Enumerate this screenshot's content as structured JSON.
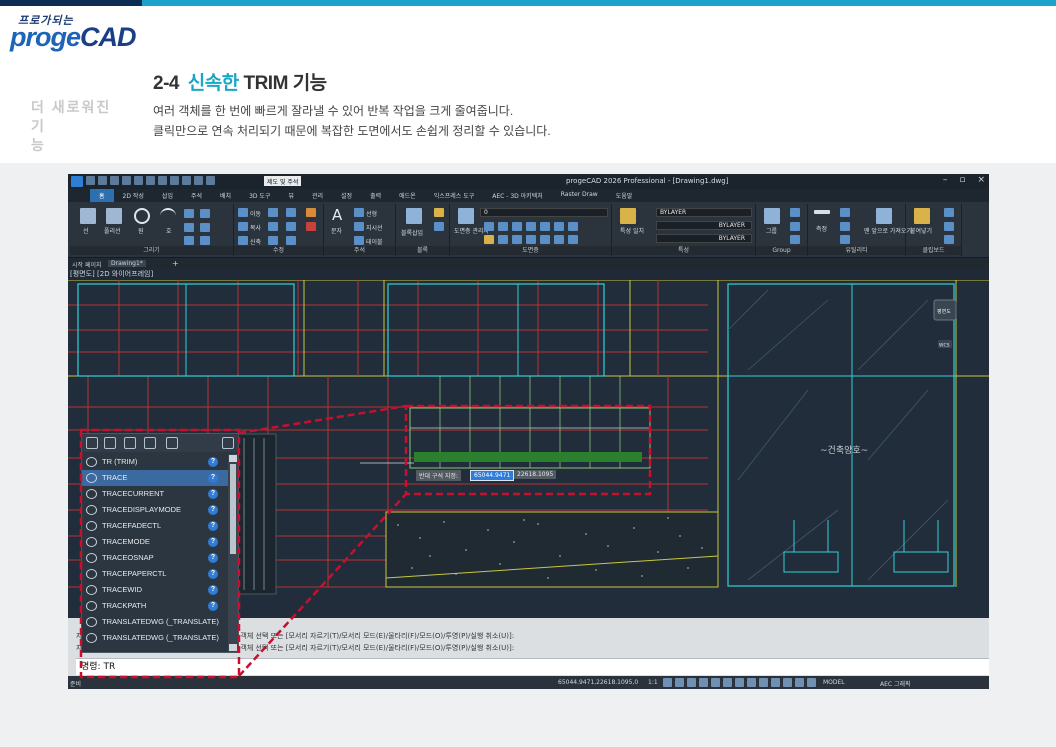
{
  "logo": {
    "tagline": "프로가되는",
    "brand_light": "proge",
    "brand_bold": "CAD"
  },
  "side_label": {
    "line1": "더 새로워진",
    "line2": "기 능"
  },
  "heading": {
    "number": "2-4",
    "title_accent": "신속한",
    "title_rest": "TRIM 기능"
  },
  "description": {
    "line1": "여러 객체를 한 번에 빠르게 잘라낼 수 있어 반복 작업을 크게 줄여줍니다.",
    "line2": "클릭만으로 연속 처리되기 때문에 복잡한 도면에서도 손쉽게 정리할 수 있습니다."
  },
  "cad": {
    "title": "progeCAD 2026 Professional - [Drawing1.dwg]",
    "workspace": "제도 및 주석",
    "window_buttons": [
      "–",
      "▫",
      "×"
    ],
    "menu_tabs": [
      "홈",
      "2D 작성",
      "삽입",
      "주석",
      "배치",
      "3D 도구",
      "뷰",
      "관리",
      "설정",
      "출력",
      "애드온",
      "익스프레스 도구",
      "AEC - 3D 아키텍처",
      "Raster Draw",
      "도움말"
    ],
    "active_tab": "홈",
    "ribbon": {
      "panels": [
        "그리기",
        "수정",
        "주석",
        "블록",
        "도면층",
        "특성",
        "Group",
        "유틸리티",
        "클립보드"
      ],
      "draw_tools": [
        "선",
        "폴리선",
        "원",
        "호"
      ],
      "modify_tools": [
        "이동",
        "복사",
        "신축"
      ],
      "annotation_tools": [
        "문자",
        "선형",
        "지시선",
        "테이블"
      ],
      "block_tools": [
        "블록삽입"
      ],
      "layer_tools": [
        "도면층 관리자"
      ],
      "layer_value": "0",
      "property_tools": [
        "특성 일치"
      ],
      "bylayer": [
        "BYLAYER",
        "BYLAYER",
        "BYLAYER"
      ],
      "group_tools": [
        "그룹"
      ],
      "utility_tools": [
        "측정",
        "붙여넣기",
        "맨 앞으로 가져오기"
      ]
    },
    "doc_tabs": [
      "시작 페이지",
      "Drawing1*",
      "+"
    ],
    "view_label": "[평면도] [2D 와이어프레임]",
    "viewcube": {
      "label": "평면도",
      "wcs": "WCS"
    },
    "dynamic_input": {
      "prompt": "반대 구석 지정:",
      "x": "65044.9471",
      "y": "22618.1095"
    },
    "room_label": "~건축양호~",
    "command_history": [
      "자를 객체를 선택하거나 shift를 누른 상태로 extend할 객체 선택 또는 [모서리 자르기(T)/모서리 모드(E)/울타리(F)/모드(O)/투영(P)/실행 취소(U)]:",
      "자를 객체를 선택하거나 shift를 누른 상태로 extend할 객체 선택 또는 [모서리 자르기(T)/모서리 모드(E)/울타리(F)/모드(O)/투영(P)/실행 취소(U)]:"
    ],
    "command_prompt": "명령:",
    "command_value": "TR",
    "status": {
      "ready": "준비",
      "coordinates": "65044.9471,22618.1095,0",
      "scale": "1:1",
      "model": "MODEL",
      "aec": "AEC 그래픽"
    },
    "autocomplete": [
      {
        "label": "TR (TRIM)",
        "icon": "trim-icon"
      },
      {
        "label": "TRACE",
        "icon": "trace-icon"
      },
      {
        "label": "TRACECURRENT",
        "icon": "gear-icon"
      },
      {
        "label": "TRACEDISPLAYMODE",
        "icon": "gear-icon"
      },
      {
        "label": "TRACEFADECTL",
        "icon": "gear-icon"
      },
      {
        "label": "TRACEMODE",
        "icon": "gear-icon"
      },
      {
        "label": "TRACEOSNAP",
        "icon": "gear-icon"
      },
      {
        "label": "TRACEPAPERCTL",
        "icon": "gear-icon"
      },
      {
        "label": "TRACEWID",
        "icon": "gear-icon"
      },
      {
        "label": "TRACKPATH",
        "icon": "gear-icon"
      },
      {
        "label": "TRANSLATEDWG (_TRANSLATE)",
        "icon": "translate-icon"
      },
      {
        "label": "TRANSLATEDWG (_TRANSLATE)",
        "icon": "translate-icon"
      }
    ],
    "selected_index": 1
  },
  "colors": {
    "accent": "#1aa7c6",
    "highlight_dash": "#c8102e",
    "navy": "#0d2c52"
  }
}
